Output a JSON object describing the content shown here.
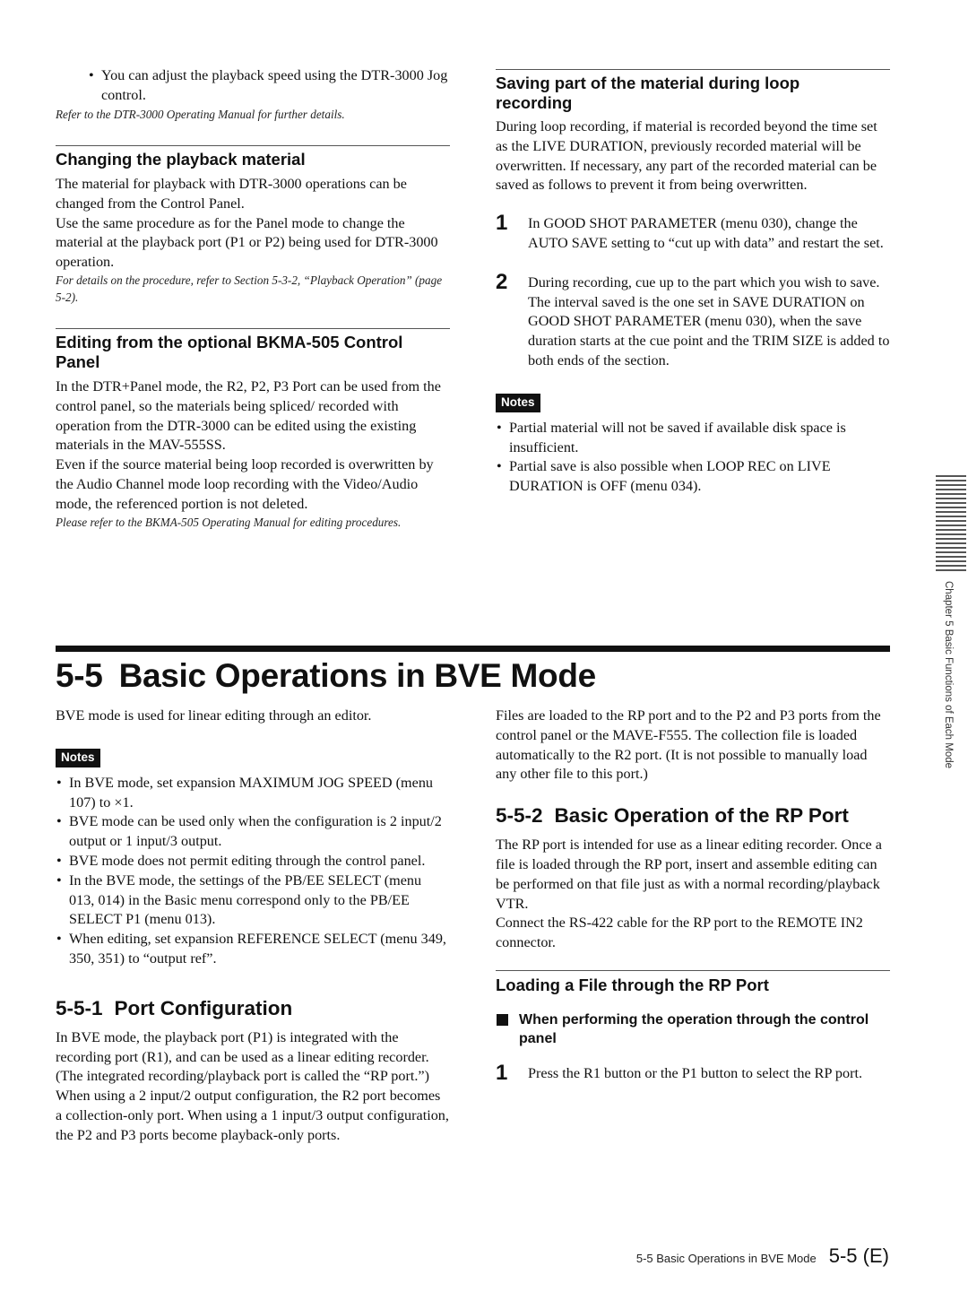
{
  "top_left": {
    "bullet": "You can adjust the playback speed using the DTR-3000 Jog control.",
    "ref": "Refer to the DTR-3000 Operating Manual for further details.",
    "changing": {
      "heading": "Changing the playback material",
      "p1": "The material for playback with DTR-3000 operations can be changed from the Control Panel.",
      "p2": "Use the same procedure as for the Panel mode to change the material at the playback port (P1 or P2) being used for DTR-3000 operation.",
      "ref": "For details on the procedure, refer to Section 5-3-2, “Playback Operation” (page 5-2)."
    },
    "editing": {
      "heading": "Editing from the optional BKMA-505 Control Panel",
      "p1": "In the DTR+Panel mode, the R2, P2, P3 Port can be used from the control panel, so the materials being spliced/ recorded with operation from the DTR-3000 can be edited using the existing materials in the MAV-555SS.",
      "p2": "Even if the source material being loop recorded is overwritten by the Audio Channel mode loop recording with the Video/Audio mode, the referenced portion is not deleted.",
      "ref": "Please refer to the BKMA-505 Operating Manual for editing procedures."
    }
  },
  "top_right": {
    "heading": "Saving part of the material during loop recording",
    "p1": "During loop recording, if material is recorded beyond the time set as the LIVE DURATION, previously recorded material will be overwritten. If necessary, any part of the recorded material can be saved as follows to prevent it from being overwritten.",
    "steps": [
      {
        "num": "1",
        "text": "In GOOD SHOT PARAMETER (menu 030), change the AUTO SAVE setting to “cut up with data” and restart the set."
      },
      {
        "num": "2",
        "text": "During recording, cue up to the part which you wish to save. The interval saved is the one set in SAVE DURATION on GOOD SHOT PARAMETER (menu 030), when the save duration starts at the cue point and the TRIM SIZE is added to both ends of the section."
      }
    ],
    "notes_label": "Notes",
    "notes": [
      "Partial material will not be saved if available disk space is insufficient.",
      "Partial save is also possible when LOOP REC on LIVE DURATION is OFF (menu 034)."
    ]
  },
  "side_tab": {
    "label": "Chapter 5   Basic Functions of Each Mode"
  },
  "section": {
    "number": "5-5",
    "title": "Basic Operations in BVE Mode",
    "intro": "BVE mode is used for linear editing through an editor.",
    "notes_label": "Notes",
    "notes": [
      "In BVE mode, set expansion MAXIMUM JOG SPEED (menu 107) to ×1.",
      "BVE mode can be used only when the configuration is 2 input/2 output or 1 input/3 output.",
      "BVE mode does not permit editing through the control panel.",
      "In the BVE mode, the settings of the PB/EE SELECT (menu 013, 014) in the Basic menu correspond only to the PB/EE SELECT P1 (menu 013).",
      "When editing, set expansion REFERENCE SELECT (menu 349, 350, 351) to “output ref”."
    ],
    "right_intro": "Files are loaded to the RP port and to the P2 and P3 ports from the control panel or the MAVE-F555.  The collection file is loaded automatically to the R2 port.  (It is not possible to manually load any other file to this port.)",
    "sub1": {
      "number": "5-5-1",
      "title": "Port Configuration",
      "p": "In BVE mode, the playback port (P1) is integrated with the recording port (R1), and can be used as a linear editing recorder.  (The integrated recording/playback port is called the “RP port.”)  When using a 2 input/2 output configuration, the R2 port becomes a collection-only port. When using a 1 input/3 output configuration, the P2 and P3 ports become playback-only ports."
    },
    "sub2": {
      "number": "5-5-2",
      "title": "Basic Operation of the RP Port",
      "p1": "The RP port is intended for use as a linear editing recorder. Once a file is loaded through the RP port, insert and assemble editing can be performed on that file just as with a normal recording/playback VTR.",
      "p2": "Connect the RS-422 cable for the RP port to the REMOTE IN2 connector."
    },
    "loading": {
      "heading": "Loading a File through the RP Port",
      "subheading": "When performing the operation through the control panel",
      "steps": [
        {
          "num": "1",
          "text": "Press the R1 button or the P1 button to select the RP port."
        }
      ]
    }
  },
  "footer": {
    "section_title": "5-5  Basic Operations in BVE Mode",
    "page": "5-5 (E)"
  }
}
